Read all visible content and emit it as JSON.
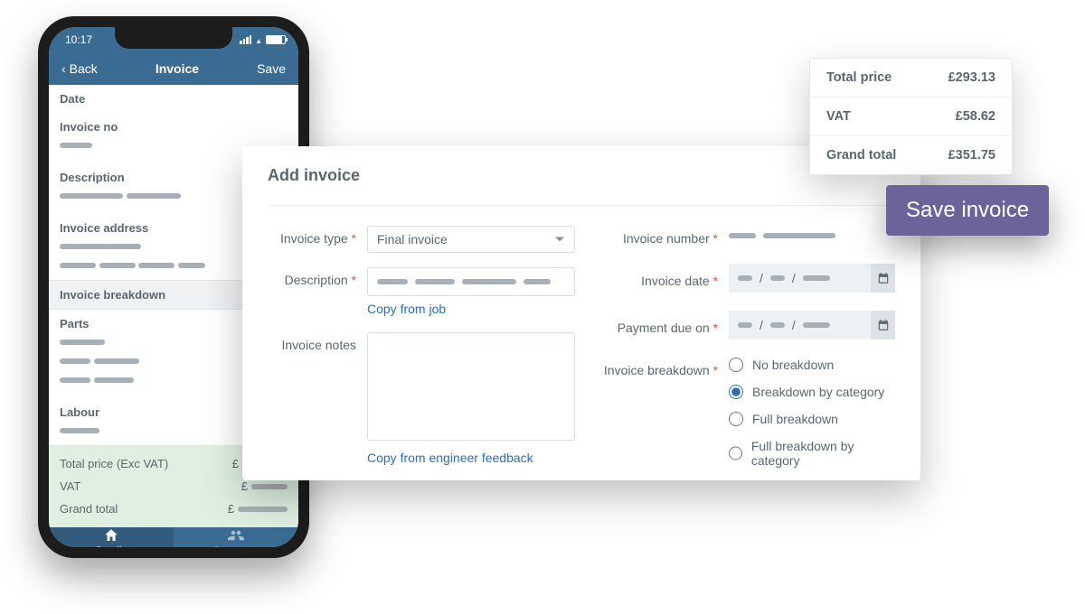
{
  "phone": {
    "status_time": "10:17",
    "back_label": "Back",
    "title": "Invoice",
    "save_label": "Save",
    "labels": {
      "date": "Date",
      "invoice_no": "Invoice no",
      "description": "Description",
      "invoice_address": "Invoice address",
      "invoice_breakdown": "Invoice breakdown",
      "parts": "Parts",
      "labour": "Labour",
      "total_ex_vat": "Total price (Exc VAT)",
      "vat": "VAT",
      "grand_total": "Grand total"
    },
    "tabs": {
      "details": "Details",
      "payments": "Payments"
    }
  },
  "card": {
    "title": "Add invoice",
    "labels": {
      "invoice_type": "Invoice type",
      "description": "Description",
      "invoice_notes": "Invoice notes",
      "invoice_number": "Invoice number",
      "invoice_date": "Invoice date",
      "payment_due": "Payment due on",
      "invoice_breakdown": "Invoice breakdown"
    },
    "invoice_type_value": "Final invoice",
    "links": {
      "copy_from_job": "Copy from job",
      "copy_from_feedback": "Copy from engineer feedback"
    },
    "breakdown_options": {
      "none": "No breakdown",
      "by_category": "Breakdown by category",
      "full": "Full breakdown",
      "full_by_category": "Full breakdown by category"
    },
    "breakdown_selected": "by_category"
  },
  "totals": {
    "total_price_label": "Total price",
    "total_price_value": "£293.13",
    "vat_label": "VAT",
    "vat_value": "£58.62",
    "grand_total_label": "Grand total",
    "grand_total_value": "£351.75"
  },
  "save_invoice_label": "Save invoice"
}
